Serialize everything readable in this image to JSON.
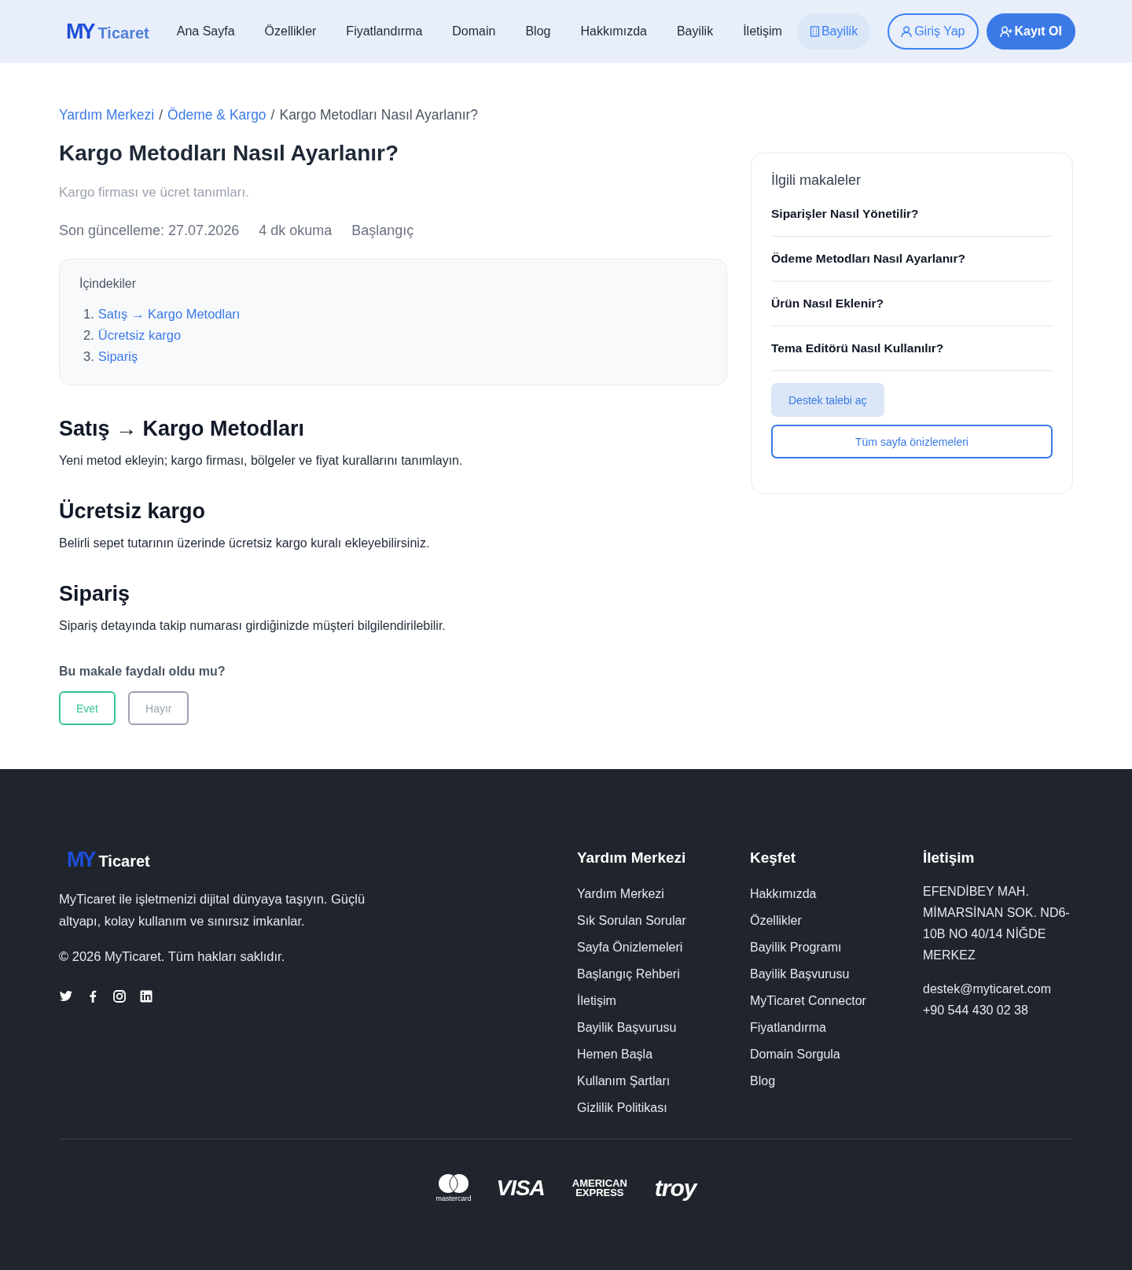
{
  "header": {
    "logo": {
      "mark": "MY",
      "word": "Ticaret"
    },
    "nav": [
      {
        "label": "Ana Sayfa",
        "kind": "link"
      },
      {
        "label": "Özellikler",
        "kind": "link"
      },
      {
        "label": "Fiyatlandırma",
        "kind": "link"
      },
      {
        "label": "Domain",
        "kind": "link"
      },
      {
        "label": "Blog",
        "kind": "link"
      },
      {
        "label": "Hakkımızda",
        "kind": "link"
      },
      {
        "label": "Bayilik",
        "kind": "link"
      },
      {
        "label": "İletişim",
        "kind": "link"
      },
      {
        "label": "Bayilik",
        "kind": "pill"
      }
    ],
    "buttons": [
      {
        "label": "Giriş Yap",
        "kind": "outline"
      },
      {
        "label": "Kayıt Ol",
        "kind": "solid"
      }
    ]
  },
  "breadcrumb": [
    {
      "label": "Yardım Merkezi",
      "link": true
    },
    {
      "label": "Ödeme & Kargo",
      "link": true
    },
    {
      "label": "Kargo Metodları Nasıl Ayarlanır?",
      "link": false
    }
  ],
  "breadcrumb_separator": "/",
  "article": {
    "title": "Kargo Metodları Nasıl Ayarlanır?",
    "subtitle": "Kargo firması ve ücret tanımları.",
    "meta": [
      "Son güncelleme: 27.07.2026",
      "4 dk okuma",
      "Başlangıç"
    ],
    "toc": {
      "title": "İçindekiler",
      "items": [
        {
          "number": "1.",
          "label": "Satış → Kargo Metodları"
        },
        {
          "number": "2.",
          "label": "Ücretsiz kargo"
        },
        {
          "number": "3.",
          "label": "Sipariş"
        }
      ]
    },
    "sections": [
      {
        "heading": "Satış → Kargo Metodları",
        "text": "Yeni metod ekleyin; kargo firması, bölgeler ve fiyat kurallarını tanımlayın."
      },
      {
        "heading": "Ücretsiz kargo",
        "text": "Belirli sepet tutarının üzerinde ücretsiz kargo kuralı ekleyebilirsiniz."
      },
      {
        "heading": "Sipariş",
        "text": "Sipariş detayında takip numarası girdiğinizde müşteri bilgilendirilebilir."
      }
    ],
    "feedback": {
      "question": "Bu makale faydalı oldu mu?",
      "buttons": [
        {
          "label": "Evet",
          "kind": "positive"
        },
        {
          "label": "Hayır",
          "kind": "negative"
        }
      ]
    }
  },
  "sidebar": {
    "title": "İlgili makaleler",
    "items": [
      "Siparişler Nasıl Yönetilir?",
      "Ödeme Metodları Nasıl Ayarlanır?",
      "Ürün Nasıl Eklenir?",
      "Tema Editörü Nasıl Kullanılır?"
    ],
    "buttons": [
      {
        "label": "Destek talebi aç",
        "kind": "soft"
      },
      {
        "label": "Tüm sayfa önizlemeleri",
        "kind": "outline"
      }
    ]
  },
  "footer": {
    "logo": {
      "mark": "MY",
      "word": "Ticaret"
    },
    "about": "MyTicaret ile işletmenizi dijital dünyaya taşıyın. Güçlü altyapı, kolay kullanım ve sınırsız imkanlar.",
    "copyright": "© 2026 MyTicaret. Tüm hakları saklıdır.",
    "social": [
      {
        "kind": "twitter"
      },
      {
        "kind": "facebook"
      },
      {
        "kind": "instagram"
      },
      {
        "kind": "linkedin"
      }
    ],
    "columns": [
      {
        "title": "Yardım Merkezi",
        "links": [
          "Yardım Merkezi",
          "Sık Sorulan Sorular",
          "Sayfa Önizlemeleri",
          "Başlangıç Rehberi",
          "İletişim",
          "Bayilik Başvurusu",
          "Hemen Başla",
          "Kullanım Şartları",
          "Gizlilik Politikası"
        ]
      },
      {
        "title": "Keşfet",
        "links": [
          "Hakkımızda",
          "Özellikler",
          "Bayilik Programı",
          "Bayilik Başvurusu",
          "MyTicaret Connector",
          "Fiyatlandırma",
          "Domain Sorgula",
          "Blog"
        ]
      }
    ],
    "contact": {
      "title": "İletişim",
      "address": "EFENDİBEY MAH. MİMARSİNAN SOK. ND6-10B NO 40/14 NİĞDE MERKEZ",
      "email": "destek@myticaret.com",
      "phone": "+90 544 430 02 38"
    },
    "payments": [
      {
        "kind": "mastercard",
        "label": "mastercard"
      },
      {
        "kind": "visa",
        "label": "VISA"
      },
      {
        "kind": "amex",
        "label": "AMERICAN EXPRESS"
      },
      {
        "kind": "troy",
        "label": "troy"
      }
    ]
  }
}
